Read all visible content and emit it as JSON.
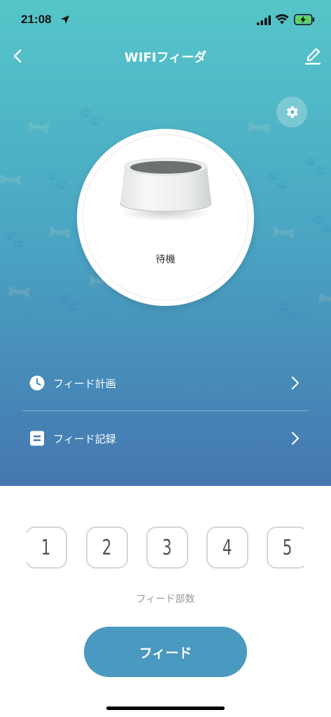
{
  "status_bar": {
    "time": "21:08"
  },
  "nav": {
    "title": "WIFIフィーダ"
  },
  "feeder": {
    "status": "待機"
  },
  "menu": [
    {
      "label": "フィード計画",
      "icon": "clock-icon"
    },
    {
      "label": "フィード記録",
      "icon": "record-icon"
    }
  ],
  "portions": [
    "1",
    "2",
    "3",
    "4",
    "5"
  ],
  "portion_label": "フィード部数",
  "feed_button": "フィード",
  "colors": {
    "gradient_top": "#56c6c9",
    "gradient_bottom": "#4577b0",
    "feed_button": "#4a99c0"
  }
}
